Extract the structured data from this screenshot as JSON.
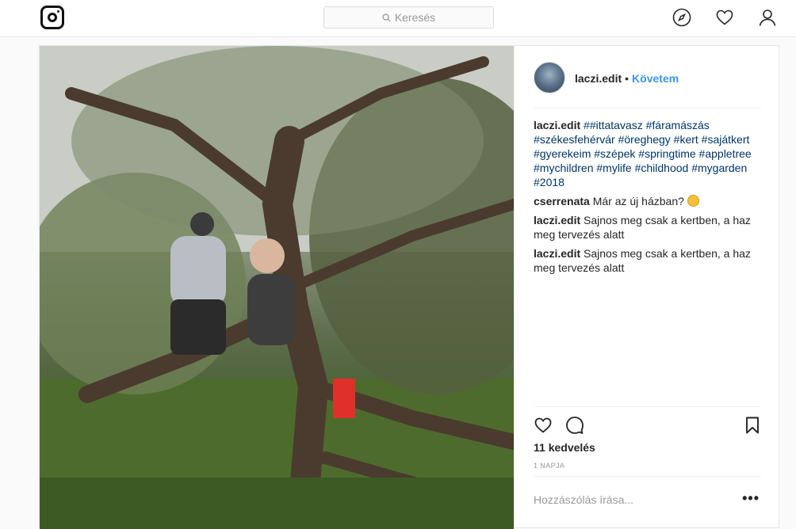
{
  "nav": {
    "search_placeholder": "Keresés"
  },
  "post": {
    "username": "laczi.edit",
    "separator": "•",
    "follow_label": "Követem",
    "caption": {
      "user": "laczi.edit",
      "text": "##ittatavasz #fáramászás #székesfehérvár #öreghegy #kert #sajátkert #gyerekeim #szépek #springtime #appletree #mychildren #mylife #childhood #mygarden #2018"
    },
    "comments": [
      {
        "user": "cserrenata",
        "text": "Már az új házban?"
      },
      {
        "user": "laczi.edit",
        "text": "Sajnos meg csak a kertben, a haz meg tervezés alatt"
      },
      {
        "user": "laczi.edit",
        "text": "Sajnos meg csak a kertben, a haz meg tervezés alatt"
      }
    ],
    "likes": "11 kedvelés",
    "time": "1 NAPJA",
    "add_comment_placeholder": "Hozzászólás írása...",
    "more_label": "•••"
  },
  "icons": {
    "logo": "instagram-logo",
    "search": "search-icon",
    "explore": "compass-icon",
    "activity": "heart-icon",
    "profile": "person-icon",
    "like": "heart-outline-icon",
    "comment": "comment-bubble-icon",
    "save": "bookmark-icon"
  },
  "colors": {
    "link": "#3897f0",
    "hashtag": "#003569",
    "text": "#262626",
    "muted": "#999999"
  }
}
